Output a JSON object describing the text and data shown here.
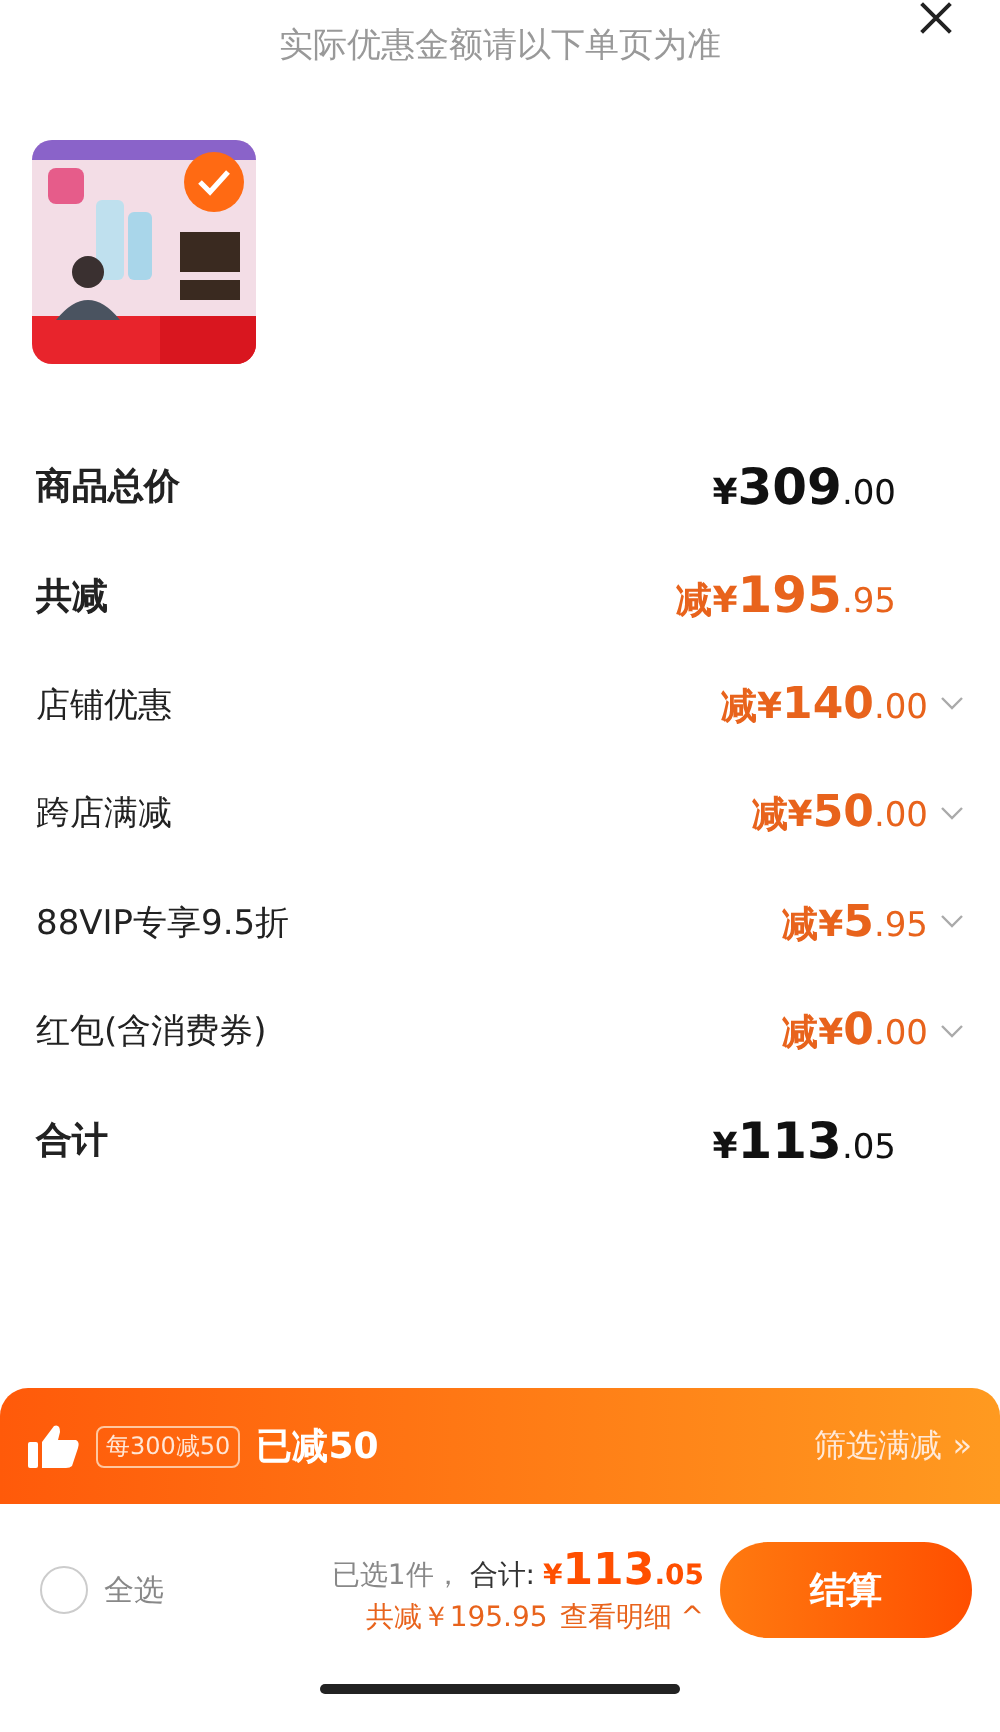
{
  "header": {
    "subtitle": "实际优惠金额请以下单页为准"
  },
  "product": {
    "kind": "picture",
    "selected": true
  },
  "rows": [
    {
      "kind": "total",
      "label": "商品总价",
      "prefix": "¥",
      "whole": "309",
      "fraction": ".00",
      "expandable": false
    },
    {
      "kind": "saving",
      "label": "共减",
      "prefix": "减¥",
      "whole": "195",
      "fraction": ".95",
      "expandable": false
    },
    {
      "kind": "item",
      "label": "店铺优惠",
      "prefix": "减¥",
      "whole": "140",
      "fraction": ".00",
      "expandable": true
    },
    {
      "kind": "item",
      "label": "跨店满减",
      "prefix": "减¥",
      "whole": "50",
      "fraction": ".00",
      "expandable": true
    },
    {
      "kind": "item",
      "label": "88VIP专享9.5折",
      "prefix": "减¥",
      "whole": "5",
      "fraction": ".95",
      "expandable": true
    },
    {
      "kind": "item",
      "label": "红包(含消费券)",
      "prefix": "减¥",
      "whole": "0",
      "fraction": ".00",
      "expandable": true
    },
    {
      "kind": "total",
      "label": "合计",
      "prefix": "¥",
      "whole": "113",
      "fraction": ".05",
      "expandable": false
    }
  ],
  "promo_bar": {
    "tag": "每300减50",
    "status": "已减50",
    "link": "筛选满减",
    "link_arrow": "»"
  },
  "footer": {
    "select_all": {
      "label": "全选",
      "checked": false
    },
    "count": "已选1件，",
    "total_label": "合计:",
    "total_prefix": "¥",
    "total_whole": "113",
    "total_fraction": ".05",
    "saving": "共减￥195.95",
    "details": "查看明细",
    "details_arrow": "^",
    "checkout": "结算"
  }
}
